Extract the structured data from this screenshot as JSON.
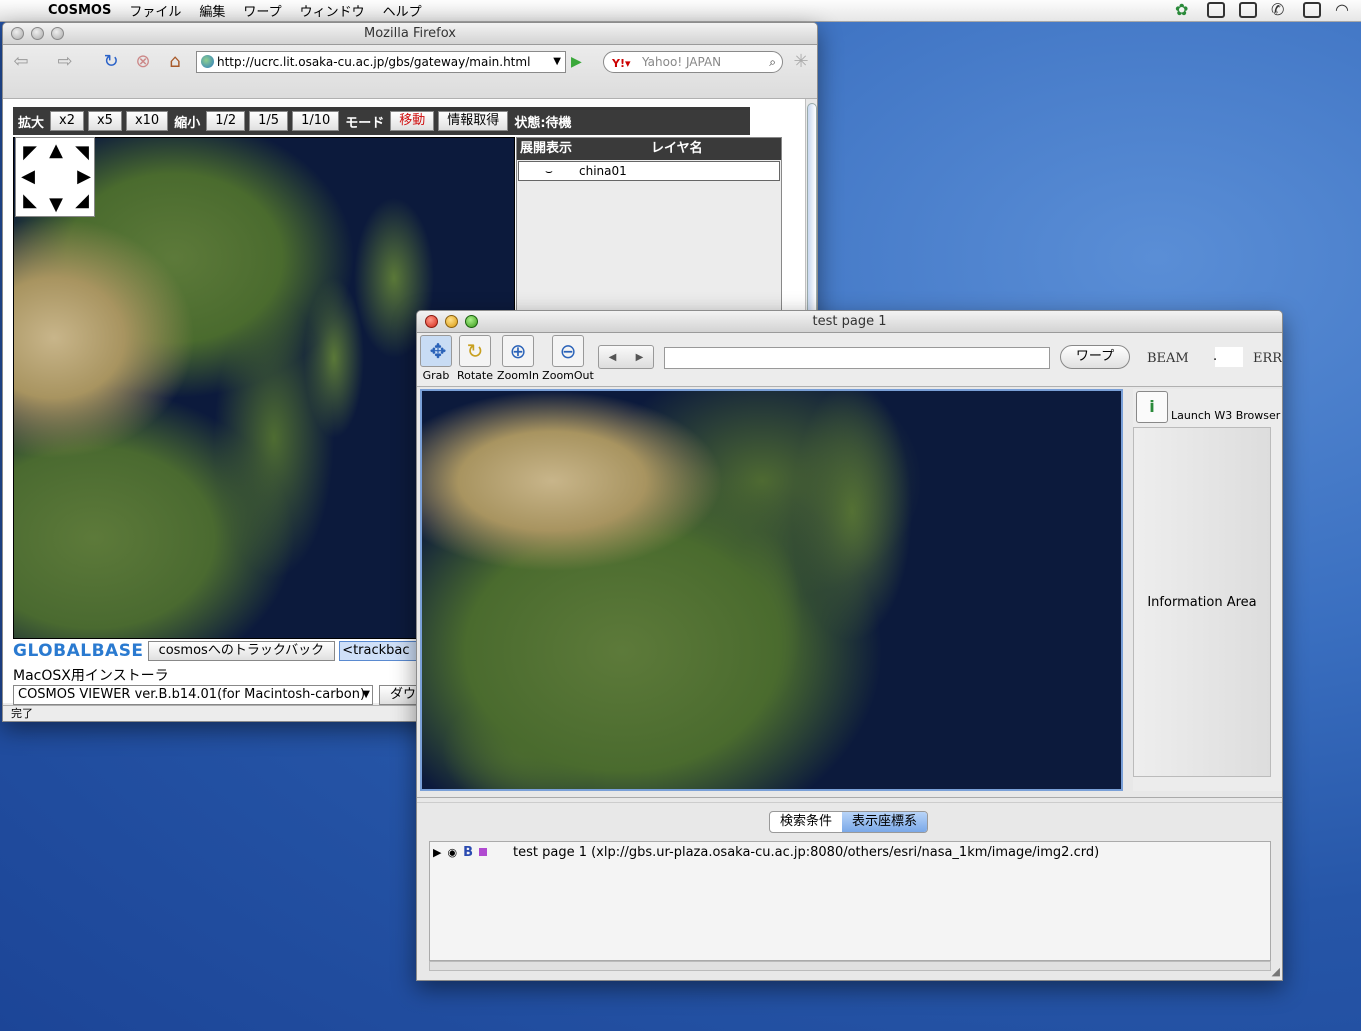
{
  "menubar": {
    "app_name": "COSMOS",
    "items": [
      "ファイル",
      "編集",
      "ワープ",
      "ウィンドウ",
      "ヘルプ"
    ]
  },
  "firefox": {
    "title": "Mozilla Firefox",
    "url": "http://ucrc.lit.osaka-cu.ac.jp/gbs/gateway/main.html",
    "search_placeholder": "Yahoo! JAPAN",
    "status": "完了",
    "toolbar": {
      "zoom_in_label": "拡大",
      "zoom_in_options": [
        "x2",
        "x5",
        "x10"
      ],
      "zoom_out_label": "縮小",
      "zoom_out_options": [
        "1/2",
        "1/5",
        "1/10"
      ],
      "mode_label": "モード",
      "move_button": "移動",
      "info_button": "情報取得",
      "state_label": "状態:待機"
    },
    "layer_panel": {
      "col_expand": "展開表示",
      "col_name": "レイヤ名",
      "rows": [
        {
          "toggle": "⌣",
          "name": "china01"
        }
      ]
    },
    "bottom": {
      "logo": "GLOBALBASE",
      "trackback_button": "cosmosへのトラックバック",
      "trackback_field": "<trackbac",
      "installer_label": "MacOSX用インストーラ",
      "viewer_select": "COSMOS VIEWER ver.B.b14.01(for Macintosh-carbon)",
      "download_button": "ダウ"
    }
  },
  "cosmos": {
    "title": "test page 1",
    "tools": [
      {
        "name": "Grab",
        "selected": true
      },
      {
        "name": "Rotate",
        "selected": false
      },
      {
        "name": "ZoomIn",
        "selected": false
      },
      {
        "name": "ZoomOut",
        "selected": false
      }
    ],
    "warp_button": "ワープ",
    "beam_label": "BEAM",
    "beam_separator": ".",
    "err_label": "ERR",
    "launch_label": "Launch W3 Browser",
    "info_area": "Information Area",
    "tabs": [
      "検索条件",
      "表示座標系"
    ],
    "active_tab": "表示座標系",
    "list_rows": [
      {
        "text": "test page 1  (xlp://gbs.ur-plaza.osaka-cu.ac.jp:8080/others/esri/nasa_1km/image/img2.crd)"
      }
    ]
  }
}
